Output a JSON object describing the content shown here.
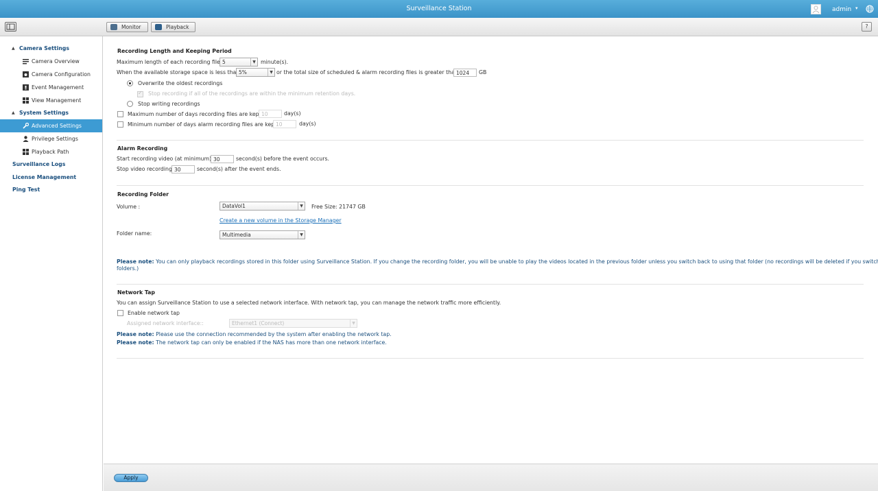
{
  "app": {
    "title": "Surveillance Station",
    "user": "admin",
    "user_caret": "▾"
  },
  "toolbar": {
    "monitor_label": "Monitor",
    "playback_label": "Playback",
    "help_label": "?"
  },
  "sidebar": {
    "camera_settings": "Camera Settings",
    "camera_overview": "Camera Overview",
    "camera_configuration": "Camera Configuration",
    "event_management": "Event Management",
    "view_management": "View Management",
    "system_settings": "System Settings",
    "advanced_settings": "Advanced Settings",
    "privilege_settings": "Privilege Settings",
    "playback_path": "Playback Path",
    "surveillance_logs": "Surveillance Logs",
    "license_management": "License Management",
    "ping_test": "Ping Test"
  },
  "recording": {
    "title": "Recording Length and Keeping Period",
    "max_length_label": "Maximum length of each recording file:",
    "max_length_value": "5",
    "max_length_unit": "minute(s).",
    "storage_label": "When the available storage space is less than",
    "storage_value": "5%",
    "total_size_label": "or the total size of scheduled & alarm recording files is greater than",
    "total_size_value": "1024",
    "total_size_unit": "GB",
    "overwrite_label": "Overwrite the oldest recordings",
    "stop_if_within_label": "Stop recording if all of the recordings are within the minimum retention days.",
    "stop_writing_label": "Stop writing recordings",
    "max_days_label": "Maximum number of days recording files are kept",
    "max_days_value": "10",
    "max_days_unit": "day(s)",
    "min_days_label": "Minimum number of days alarm recording files are kept",
    "min_days_value": "10",
    "min_days_unit": "day(s)"
  },
  "alarm": {
    "title": "Alarm Recording",
    "start_label": "Start recording video (at minimum)",
    "start_value": "30",
    "start_suffix": "second(s) before the event occurs.",
    "stop_label": "Stop video recording",
    "stop_value": "30",
    "stop_suffix": "second(s) after the event ends."
  },
  "folder": {
    "title": "Recording Folder",
    "volume_label": "Volume :",
    "volume_value": "DataVol1",
    "free_size": "Free Size: 21747 GB",
    "create_volume_link": "Create a new volume in the Storage Manager",
    "folder_label": "Folder name:",
    "folder_value": "Multimedia",
    "note_label": "Please note:",
    "note_text": " You can only playback recordings stored in this folder using Surveillance Station. If you change the recording folder, you will be unable to play the videos located in the previous folder unless you switch back to using that folder (no recordings will be deleted if you switch",
    "note_text_2": "folders.)"
  },
  "network": {
    "title": "Network Tap",
    "description": "You can assign Surveillance Station to use a selected network interface. With network tap, you can manage the network traffic more efficiently.",
    "enable_label": "Enable network tap",
    "interface_label": "Assigned network interface::",
    "interface_value": "Ethernet1 (Connect)",
    "note_label": "Please note:",
    "note1_text": " Please use the connection recommended by the system after enabling the network tap.",
    "note2_text": " The network tap can only be enabled if the NAS has more than one network interface."
  },
  "footer": {
    "apply_label": "Apply"
  }
}
